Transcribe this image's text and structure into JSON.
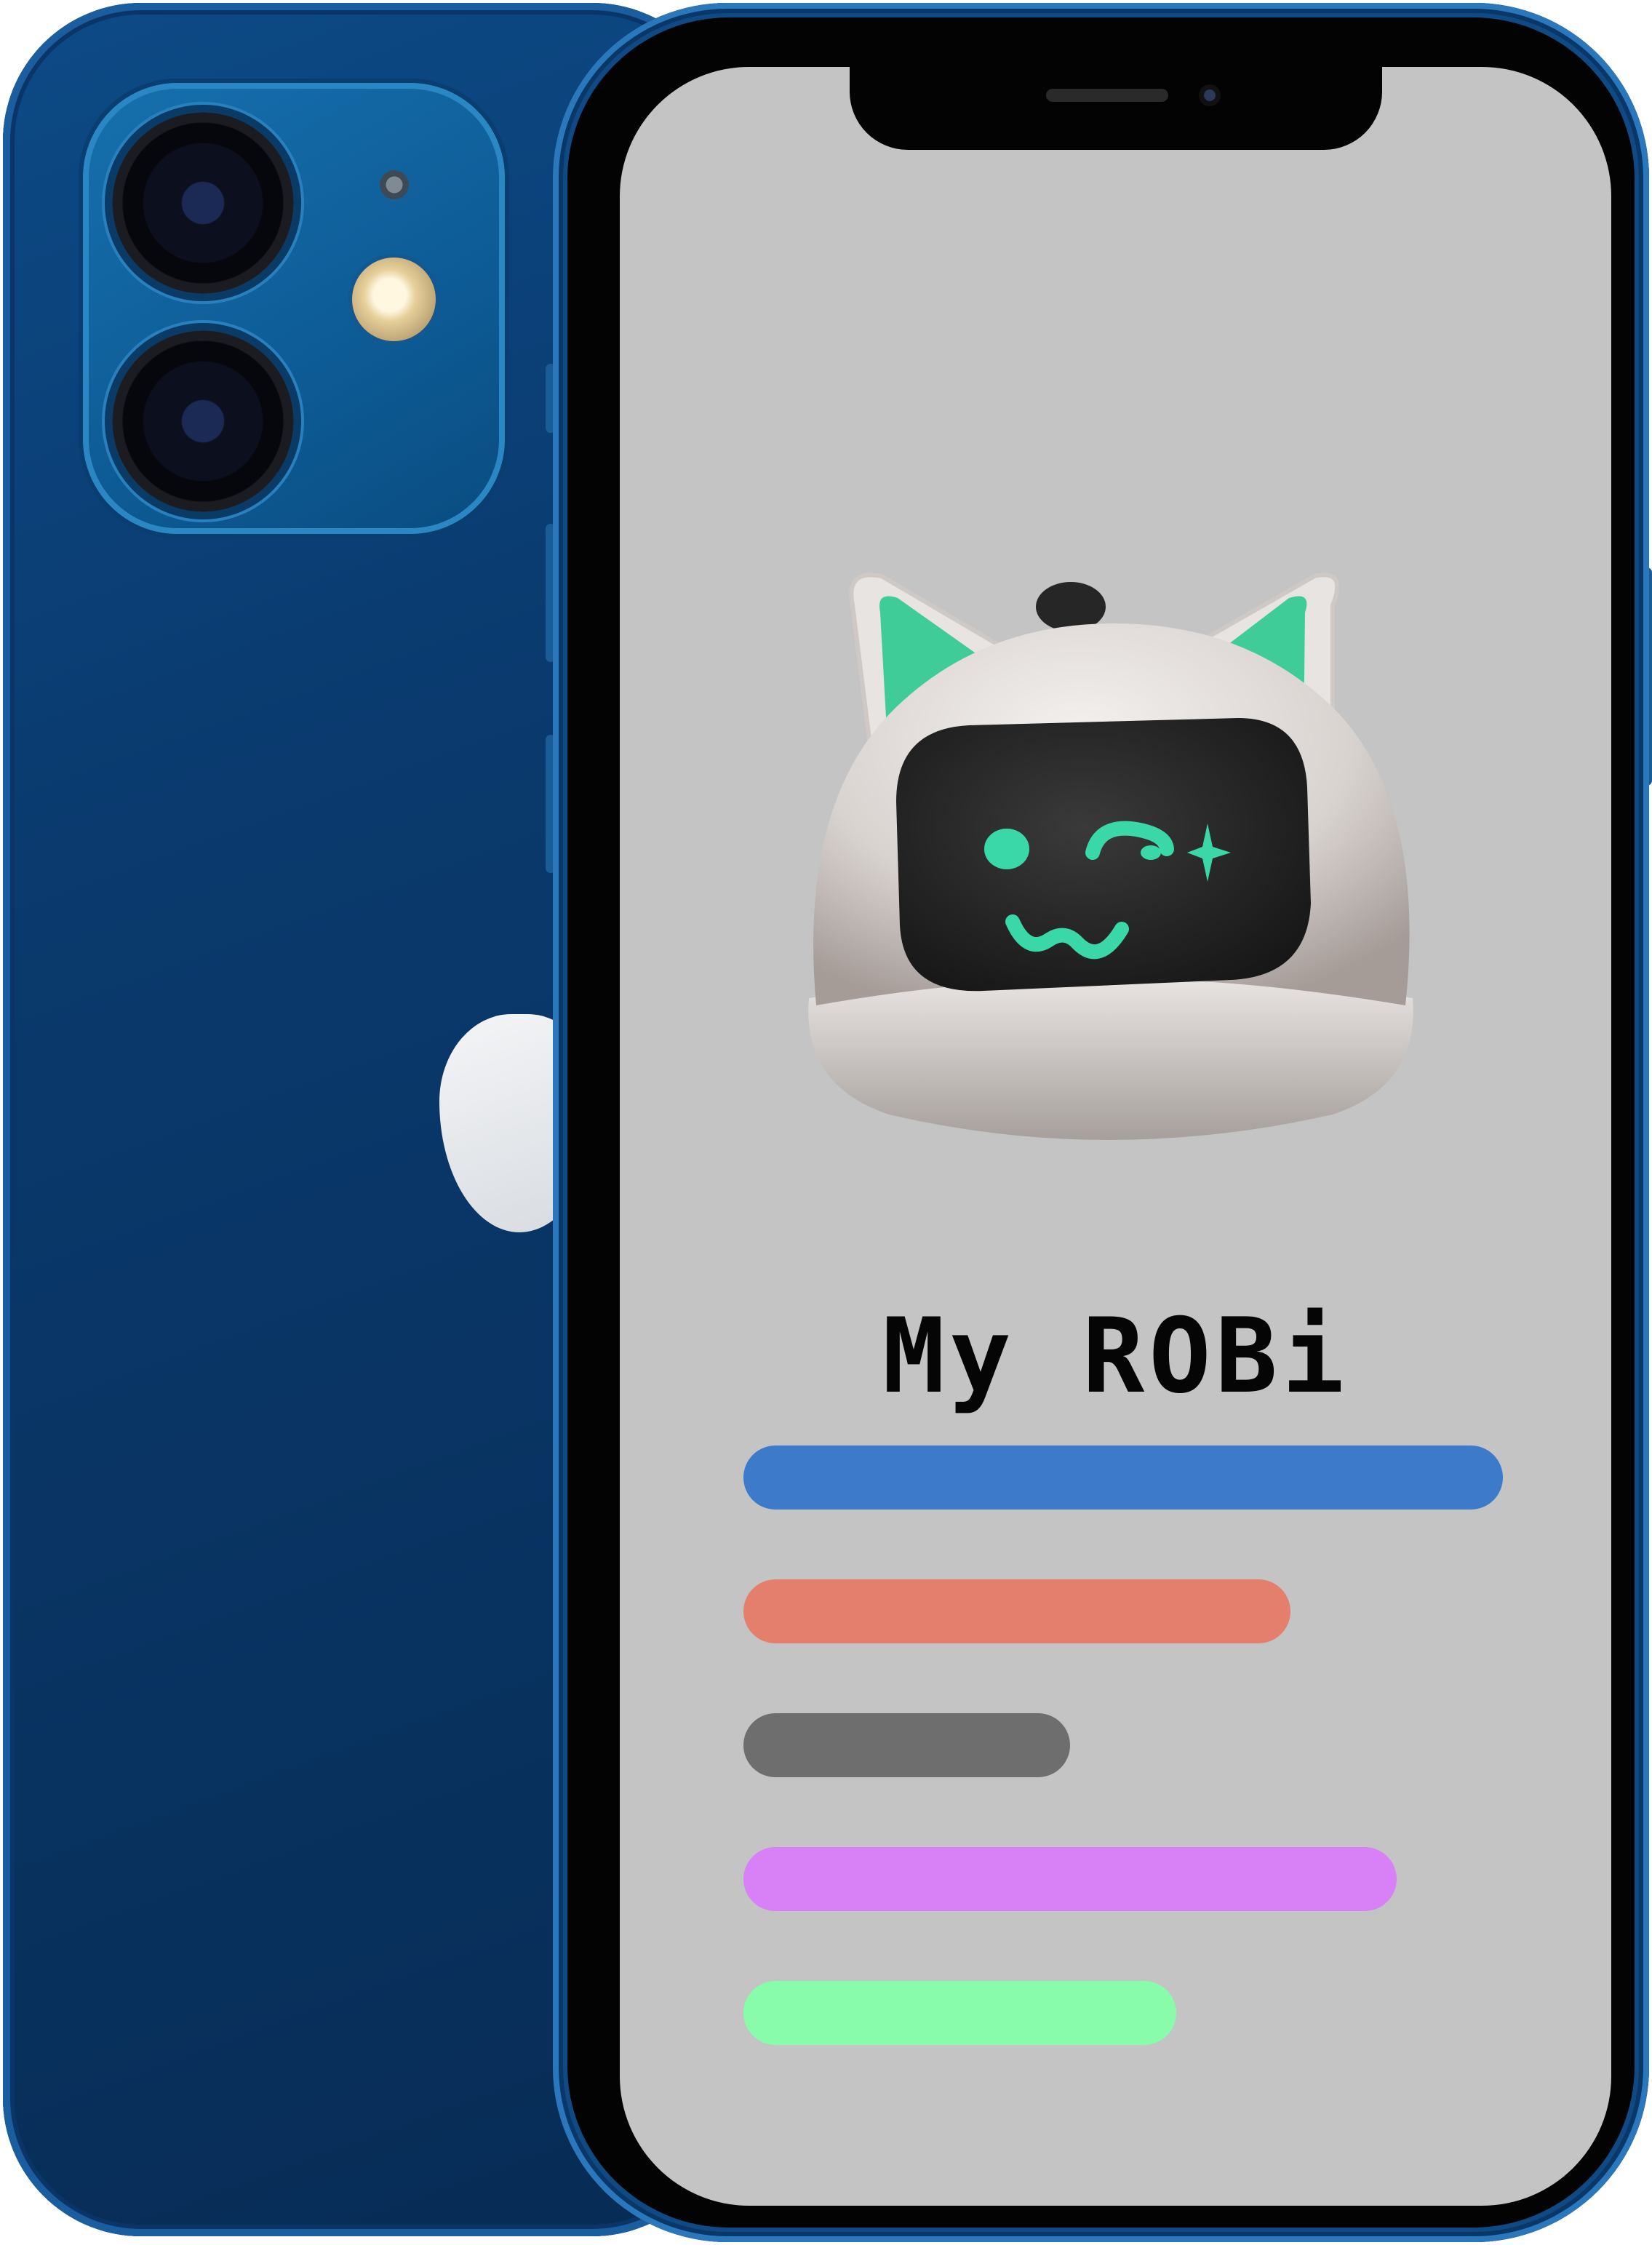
{
  "screen": {
    "title": "My ROBi",
    "mascot_icon": "robot-cat-mascot-icon",
    "bars": [
      {
        "color": "#3d7bca",
        "fill": 1.0
      },
      {
        "color": "#e57f6d",
        "fill": 0.72
      },
      {
        "color": "#6e6e6e",
        "fill": 0.43
      },
      {
        "color": "#d880f6",
        "fill": 0.86
      },
      {
        "color": "#88fcaa",
        "fill": 0.57
      }
    ]
  },
  "device": {
    "body_color": "#0a3a6e",
    "screen_background": "#c4c4c4",
    "accent_face_color": "#3ad8a8"
  }
}
